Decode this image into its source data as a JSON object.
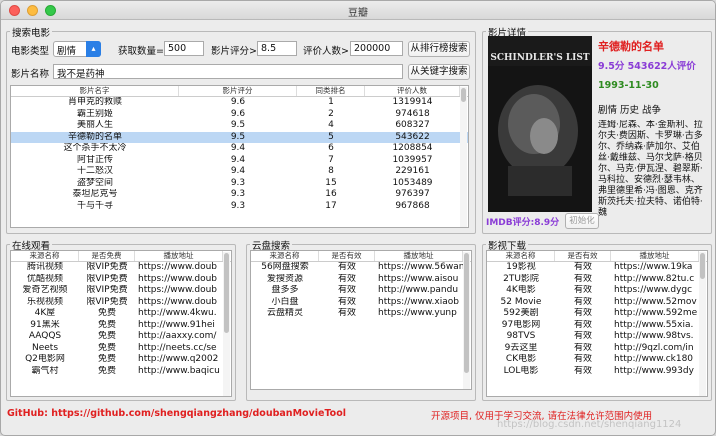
{
  "window": {
    "title": "豆瓣"
  },
  "search": {
    "group_title": "搜索电影",
    "type_label": "电影类型",
    "type_value": "剧情",
    "count_label": "获取数量=",
    "count_value": "500",
    "rating_label": "影片评分>",
    "rating_value": "8.5",
    "votes_label": "评价人数>",
    "votes_value": "200000",
    "rank_button": "从排行榜搜索",
    "name_label": "影片名称",
    "name_value": "我不是药神",
    "keyword_button": "从关键字搜索"
  },
  "movies": {
    "headers": [
      "影片名字",
      "影片评分",
      "同类排名",
      "评价人数"
    ],
    "rows": [
      [
        "肖申克的救赎",
        "9.6",
        "1",
        "1319914"
      ],
      [
        "霸王别姬",
        "9.6",
        "2",
        "974618"
      ],
      [
        "美丽人生",
        "9.5",
        "4",
        "608327"
      ],
      [
        "辛德勒的名单",
        "9.5",
        "5",
        "543622"
      ],
      [
        "这个杀手不太冷",
        "9.4",
        "6",
        "1208854"
      ],
      [
        "阿甘正传",
        "9.4",
        "7",
        "1039957"
      ],
      [
        "十二怒汉",
        "9.4",
        "8",
        "229161"
      ],
      [
        "盗梦空间",
        "9.3",
        "15",
        "1053489"
      ],
      [
        "泰坦尼克号",
        "9.3",
        "16",
        "976397"
      ],
      [
        "千与千寻",
        "9.3",
        "17",
        "967868"
      ]
    ],
    "selected_index": 3
  },
  "detail": {
    "group_title": "影片详情",
    "poster_text": "SCHINDLER'S LIST",
    "title": "辛德勒的名单",
    "score_line": "9.5分 543622人评价",
    "date": "1993-11-30",
    "genres": "剧情 历史 战争",
    "cast": "连姆·尼森、本·金斯利、拉尔夫·费因斯、卡罗琳·古多尔、乔纳森·萨加尔、艾伯丝·戴维兹、马尔戈萨·格贝尔、马克·伊瓦涅、碧翠斯·马科拉、安德烈·瑟韦林、弗里德里希·冯·图恩、克齐斯茨托夫·拉夫特、诺伯特·魏",
    "imdb_label": "IMDB评分:8.9分",
    "init_button": "初始化"
  },
  "online": {
    "group_title": "在线观看",
    "headers": [
      "来源名称",
      "是否免费",
      "播放地址"
    ],
    "rows": [
      [
        "腾讯视频",
        "限VIP免费",
        "https://www.doub"
      ],
      [
        "优酷视频",
        "限VIP免费",
        "https://www.doub"
      ],
      [
        "爱奇艺视频",
        "限VIP免费",
        "https://www.doub"
      ],
      [
        "乐视视频",
        "限VIP免费",
        "https://www.doub"
      ],
      [
        "4K屋",
        "免费",
        "http://www.4kwu."
      ],
      [
        "91黑米",
        "免费",
        "http://www.91hei"
      ],
      [
        "AAQQS",
        "免费",
        "http://aaxxy.com/"
      ],
      [
        "Neets",
        "免费",
        "http://neets.cc/se"
      ],
      [
        "Q2电影网",
        "免费",
        "http://www.q2002"
      ],
      [
        "霸气村",
        "免费",
        "http://www.baqicu"
      ]
    ]
  },
  "cloud": {
    "group_title": "云盘搜索",
    "headers": [
      "来源名称",
      "是否有效",
      "播放地址"
    ],
    "rows": [
      [
        "56网盘搜索",
        "有效",
        "https://www.56wan"
      ],
      [
        "爱搜资源",
        "有效",
        "https://www.aisou"
      ],
      [
        "盘多多",
        "有效",
        "http://www.pandu"
      ],
      [
        "小白盘",
        "有效",
        "https://www.xiaob"
      ],
      [
        "云盘精灵",
        "有效",
        "https://www.yunp"
      ]
    ]
  },
  "download": {
    "group_title": "影视下载",
    "headers": [
      "来源名称",
      "是否有效",
      "播放地址"
    ],
    "rows": [
      [
        "19影视",
        "有效",
        "https://www.19ka"
      ],
      [
        "2TU影院",
        "有效",
        "http://www.82tu.c"
      ],
      [
        "4K电影",
        "有效",
        "https://www.dygc"
      ],
      [
        "52 Movie",
        "有效",
        "http://www.52mov"
      ],
      [
        "592美剧",
        "有效",
        "http://www.592me"
      ],
      [
        "97电影网",
        "有效",
        "http://www.55xia."
      ],
      [
        "98TVS",
        "有效",
        "http://www.98tvs."
      ],
      [
        "9去这里",
        "有效",
        "http://9qzl.com/in"
      ],
      [
        "CK电影",
        "有效",
        "http://www.ck180"
      ],
      [
        "LOL电影",
        "有效",
        "http://www.993dy"
      ]
    ]
  },
  "footer": {
    "github": "GitHub: https://github.com/shengqiangzhang/doubanMovieTool",
    "notice": "开源项目, 仅用于学习交流, 请在法律允许范围内使用",
    "watermark": "https://blog.csdn.net/shenqiang1124"
  },
  "colors": {
    "selection": "#bcd7f4",
    "accent_red": "#e02020",
    "accent_purple": "#8a3cd6",
    "accent_green": "#2e8b20",
    "select_blue": "#2a7fe6"
  }
}
